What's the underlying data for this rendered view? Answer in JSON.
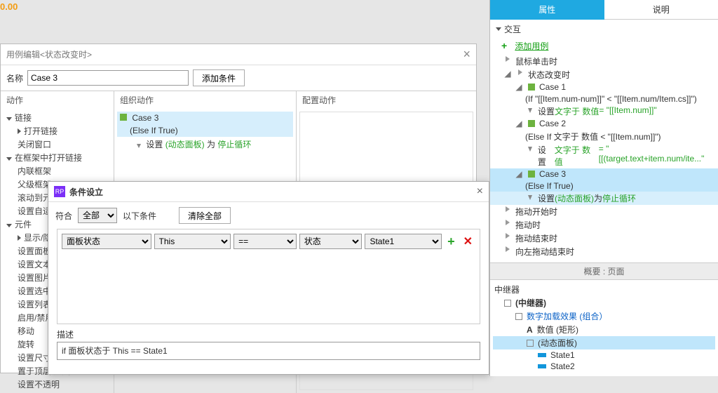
{
  "corner_value": "0.00",
  "case_dialog": {
    "title": "用例编辑<状态改变时>",
    "name_label": "名称",
    "name_value": "Case 3",
    "add_condition": "添加条件",
    "col_actions": "动作",
    "col_org": "组织动作",
    "col_config": "配置动作",
    "actions": {
      "links": "链接",
      "open_link": "打开链接",
      "close_window": "关闭窗口",
      "open_in_frame": "在框架中打开链接",
      "inner_frame": "内联框架",
      "parent_frame": "父级框架",
      "scroll_to": "滚动到元件<锚链接>",
      "adaptive": "设置自适应视图",
      "widgets": "元件",
      "show_hide": "显示/隐藏",
      "panel_state": "设置面板状态",
      "set_text": "设置文本",
      "set_image": "设置图片",
      "set_selected": "设置选中",
      "set_list_sel": "设置列表选中项",
      "enable_disable": "启用/禁用",
      "move": "移动",
      "rotate": "旋转",
      "set_size": "设置尺寸",
      "bring_front": "置于顶层/底层",
      "opacity": "设置不透明"
    },
    "org": {
      "case_name": "Case 3",
      "case_cond": "(Else If True)",
      "set_prefix": "设置 ",
      "target": "(动态面板)",
      "to": " 为 ",
      "value": "停止循环"
    }
  },
  "cond_dialog": {
    "title": "条件设立",
    "match_label": "符合",
    "match_value": "全部",
    "match_suffix": "以下条件",
    "clear_all": "清除全部",
    "row": {
      "lhs_type": "面板状态",
      "lhs_target": "This",
      "op": "==",
      "rhs_type": "状态",
      "rhs_value": "State1"
    },
    "desc_label": "描述",
    "desc_text": "if 面板状态于 This == State1"
  },
  "inspector": {
    "tab_props": "属性",
    "tab_notes": "说明",
    "section_ix": "交互",
    "add_case": "添加用例",
    "events": {
      "click": "鼠标单击时",
      "state_change": "状态改变时",
      "c1_name": "Case 1",
      "c1_cond": "(If \"[[Item.num-num]]\" < \"[[Item.num/Item.cs]]\")",
      "c1_act_pre": "设置 ",
      "c1_act_mid": "文字于 数值",
      "c1_act_val": " = \"[[Item.num]]\"",
      "c2_name": "Case 2",
      "c2_cond": "(Else If 文字于 数值 < \"[[Item.num]]\")",
      "c2_act_pre": "设置 ",
      "c2_act_mid": "文字于 数值",
      "c2_act_val": " = \"[[(target.text+item.num/ite...\"",
      "c3_name": "Case 3",
      "c3_cond": "(Else If True)",
      "c3_act_pre": "设置 ",
      "c3_act_mid": "(动态面板)",
      "c3_act_to": " 为 ",
      "c3_act_val": "停止循环",
      "drag_start": "拖动开始时",
      "drag": "拖动时",
      "drag_end": "拖动结束时",
      "scroll_end": "向左拖动结束时"
    },
    "outline_head": "概要 : 页面",
    "outline": {
      "repeater": "中继器",
      "repeater2": "(中继器)",
      "group": "数字加载效果 (组合）",
      "num_rect": "数值 (矩形)",
      "dp": "(动态面板)",
      "s1": "State1",
      "s2": "State2"
    }
  }
}
